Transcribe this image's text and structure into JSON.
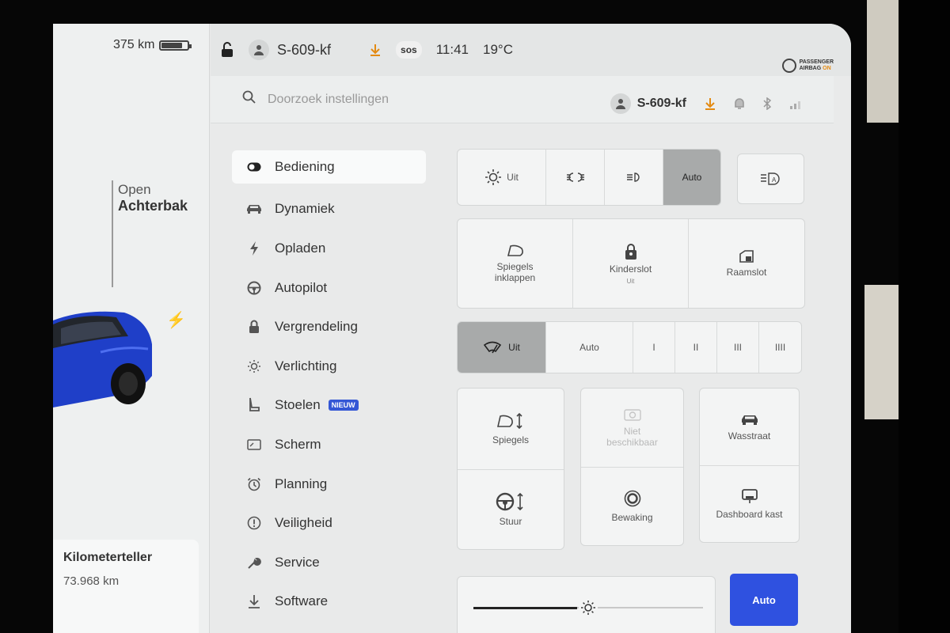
{
  "left_pane": {
    "range": "375 km",
    "battery_level": 0.8,
    "trunk_state": "Open",
    "trunk_label": "Achterbak",
    "odometer_title": "Kilometerteller",
    "odometer_value": "73.968",
    "odometer_unit": "km"
  },
  "status_bar": {
    "plate": "S-609-kf",
    "sos": "sos",
    "time": "11:41",
    "temperature": "19°C",
    "airbag_line1": "PASSENGER",
    "airbag_line2": "AIRBAG",
    "airbag_state": "ON"
  },
  "header": {
    "search_placeholder": "Doorzoek instellingen",
    "plate": "S-609-kf"
  },
  "menu": {
    "items": [
      {
        "label": "Bediening",
        "icon": "toggle-icon",
        "active": true
      },
      {
        "label": "Dynamiek",
        "icon": "car-icon"
      },
      {
        "label": "Opladen",
        "icon": "bolt-icon"
      },
      {
        "label": "Autopilot",
        "icon": "steering-wheel-icon"
      },
      {
        "label": "Vergrendeling",
        "icon": "lock-icon"
      },
      {
        "label": "Verlichting",
        "icon": "sun-icon"
      },
      {
        "label": "Stoelen",
        "icon": "seat-icon",
        "badge": "NIEUW"
      },
      {
        "label": "Scherm",
        "icon": "display-icon"
      },
      {
        "label": "Planning",
        "icon": "alarm-clock-icon"
      },
      {
        "label": "Veiligheid",
        "icon": "alert-circle-icon"
      },
      {
        "label": "Service",
        "icon": "wrench-icon"
      },
      {
        "label": "Software",
        "icon": "download-icon"
      }
    ]
  },
  "lights": {
    "off_label": "Uit",
    "auto_label": "Auto",
    "selected": "Auto"
  },
  "tiles_row2": {
    "mirrors_fold": "Spiegels inklappen",
    "child_lock": "Kinderslot",
    "child_lock_state": "Uit",
    "window_lock": "Raamslot"
  },
  "wipers": {
    "off_label": "Uit",
    "auto_label": "Auto",
    "speeds": [
      "I",
      "II",
      "III",
      "IIII"
    ],
    "selected": "Uit"
  },
  "grid": {
    "mirrors": "Spiegels",
    "steering": "Stuur",
    "unavailable": "Niet beschikbaar",
    "monitoring": "Bewaking",
    "car_wash": "Wasstraat",
    "glovebox": "Dashboard kast"
  },
  "brightness": {
    "level": 0.5,
    "auto_label": "Auto"
  },
  "colors": {
    "accent": "#2f51e0",
    "download": "#e38a12",
    "badge": "#3457d5"
  }
}
